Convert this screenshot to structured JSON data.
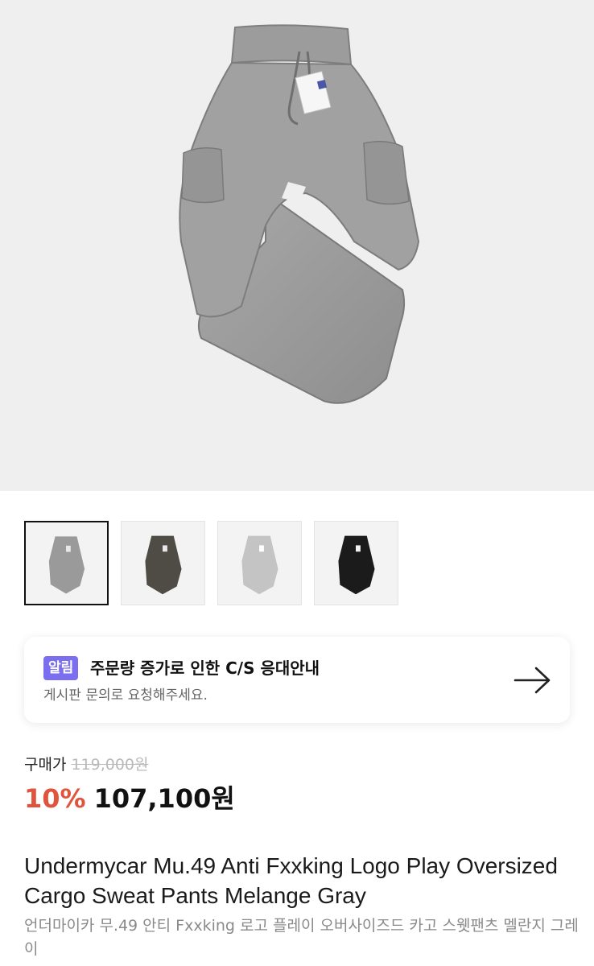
{
  "hero": {
    "image": "melange-gray-cargo-sweatpants"
  },
  "thumbnails": [
    {
      "name": "thumb-melange-gray",
      "color": "#9a9a9a",
      "selected": true
    },
    {
      "name": "thumb-charcoal",
      "color": "#4f4b45",
      "selected": false
    },
    {
      "name": "thumb-light-gray",
      "color": "#c4c4c4",
      "selected": false
    },
    {
      "name": "thumb-black",
      "color": "#1b1b1b",
      "selected": false
    }
  ],
  "notice": {
    "badge": "알림",
    "title": "주문량 증가로 인한 C/S 응대안내",
    "subtitle": "게시판 문의로 요청해주세요.",
    "arrow_icon": "arrow-right-icon"
  },
  "price": {
    "label": "구매가",
    "original": "119,000원",
    "discount": "10%",
    "sale": "107,100원"
  },
  "product": {
    "title_en": "Undermycar Mu.49 Anti Fxxking Logo Play Oversized Cargo Sweat Pants Melange Gray",
    "title_ko": "언더마이카 무.49 안티 Fxxking 로고 플레이 오버사이즈드 카고 스웻팬츠 멜란지 그레이"
  },
  "colors": {
    "accent_badge": "#7b6ff0",
    "discount": "#e0543e",
    "hero_bg": "#efefef"
  }
}
